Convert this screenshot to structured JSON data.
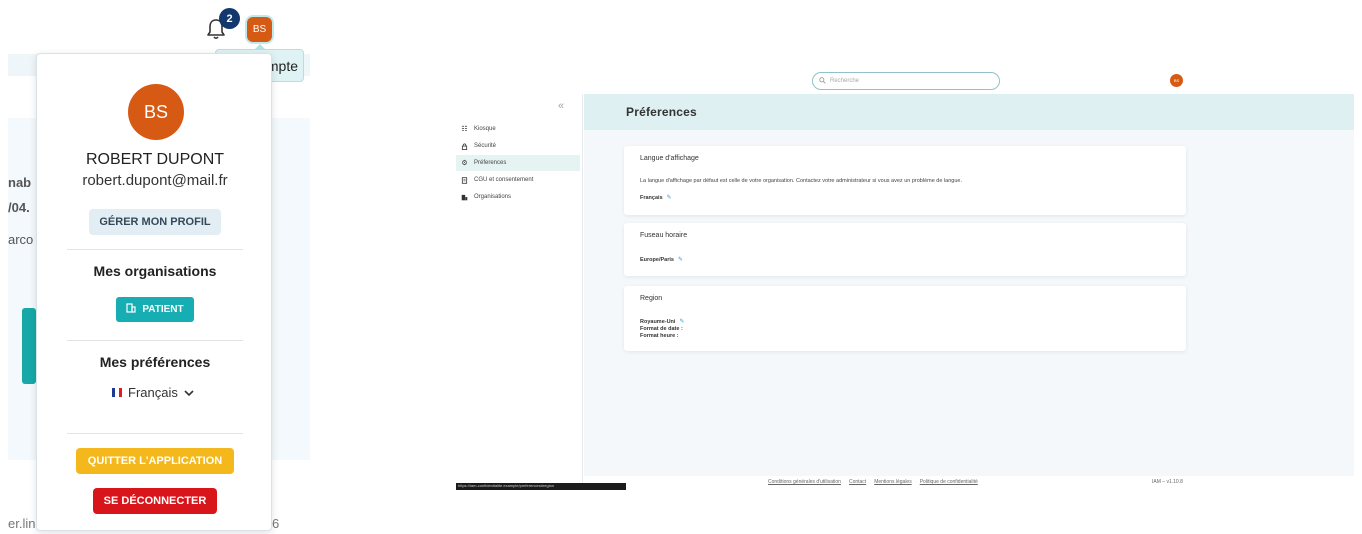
{
  "account_menu": {
    "notifications_count": "2",
    "avatar_initials": "BS",
    "tooltip": "Mon compte",
    "card_initials": "BS",
    "user_name": "ROBERT DUPONT",
    "user_email": "robert.dupont@mail.fr",
    "manage_profile_label": "GÉRER MON PROFIL",
    "organisations_title": "Mes organisations",
    "organisation_button": "PATIENT",
    "preferences_title": "Mes préférences",
    "language": "Français",
    "quit_label": "QUITTER L'APPLICATION",
    "logout_label": "SE DÉCONNECTER",
    "background_text": [
      "nab",
      "/04.",
      "arco"
    ],
    "background_link": "er.link",
    "background_number": "6"
  },
  "preferences_page": {
    "search_placeholder": "Recherche",
    "avatar_initials": "BS",
    "collapse_label": "«",
    "sidebar": [
      {
        "label": "Kiosque",
        "icon": "grid-icon"
      },
      {
        "label": "Sécurité",
        "icon": "lock-icon"
      },
      {
        "label": "Préferences",
        "icon": "gear-icon"
      },
      {
        "label": "CGU et consentement",
        "icon": "document-icon"
      },
      {
        "label": "Organisations",
        "icon": "building-icon"
      }
    ],
    "title": "Préferences",
    "language_card": {
      "title": "Langue d'affichage",
      "text": "La langue d'affichage par défaut est celle de votre organisation. Contactez votre administrateur si vous avez un problème de langue.",
      "value": "Français"
    },
    "timezone_card": {
      "title": "Fuseau horaire",
      "value": "Europe/Paris"
    },
    "region_card": {
      "title": "Region",
      "value": "Royaume-Uni",
      "date_format_label": "Format de date :",
      "time_format_label": "Format heure :"
    },
    "footer_links": [
      "Conditions générales d'utilisation",
      "Contact",
      "Mentions légales",
      "Politique de confidentialité"
    ],
    "version": "IAM – v1.10.8",
    "status_text": "https://iam-confidentialite.example/preferences#region"
  },
  "colors": {
    "accent": "#17aeb3",
    "avatar": "#d65a14",
    "quit": "#f5b81c",
    "logout": "#d8151b",
    "badge": "#13386e"
  }
}
